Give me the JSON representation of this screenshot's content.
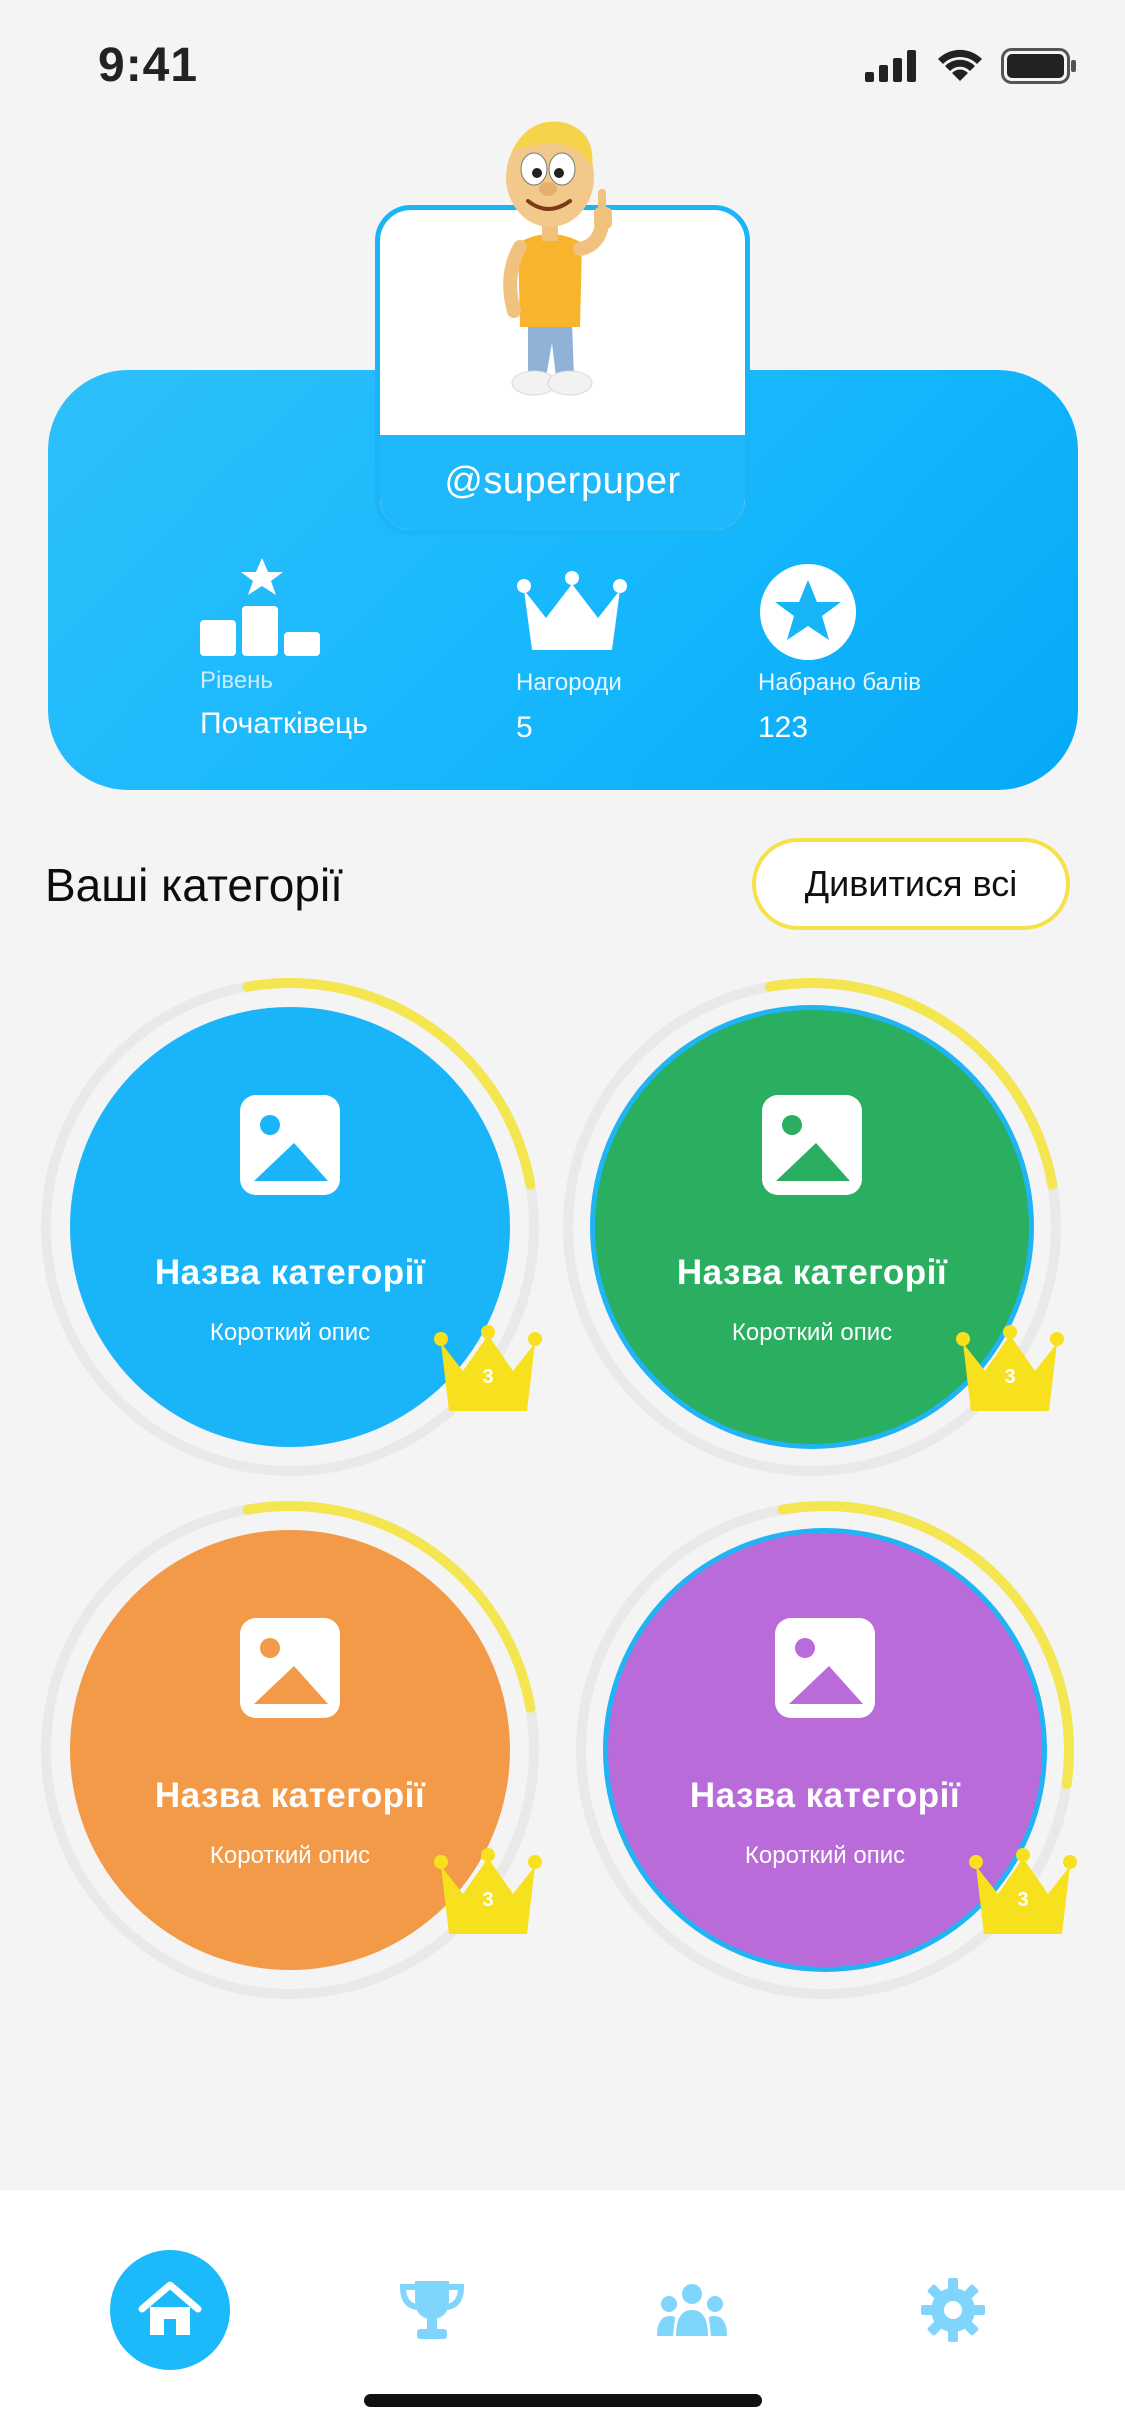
{
  "status_bar": {
    "time": "9:41"
  },
  "profile": {
    "username": "@superpuper",
    "stats": [
      {
        "label": "Рівень",
        "value": "Початківець",
        "icon": "podium-star-icon"
      },
      {
        "label": "Нагороди",
        "value": "5",
        "icon": "crown-icon"
      },
      {
        "label": "Набрано балів",
        "value": "123",
        "icon": "star-circle-icon"
      }
    ]
  },
  "categories_section": {
    "title": "Ваші категорії",
    "see_all_label": "Дивитися всі"
  },
  "categories": [
    {
      "title": "Назва категорії",
      "description": "Короткий опис",
      "crown_count": "3",
      "color": "#1ab5f8",
      "progress": 0.25
    },
    {
      "title": "Назва категорії",
      "description": "Короткий опис",
      "crown_count": "3",
      "color": "#2aae60",
      "progress": 0.25
    },
    {
      "title": "Назва категорії",
      "description": "Короткий опис",
      "crown_count": "3",
      "color": "#f29a48",
      "progress": 0.25
    },
    {
      "title": "Назва категорії",
      "description": "Короткий опис",
      "crown_count": "3",
      "color": "#b96bd9",
      "progress": 0.3
    }
  ],
  "colors": {
    "accent": "#1cb9fb",
    "progress": "#f3e651",
    "crown": "#f7e01e",
    "nav_icon": "#7fd5fb"
  },
  "nav": [
    {
      "name": "home",
      "icon": "home-icon",
      "active": true
    },
    {
      "name": "awards",
      "icon": "trophy-icon",
      "active": false
    },
    {
      "name": "friends",
      "icon": "users-icon",
      "active": false
    },
    {
      "name": "settings",
      "icon": "gear-icon",
      "active": false
    }
  ]
}
